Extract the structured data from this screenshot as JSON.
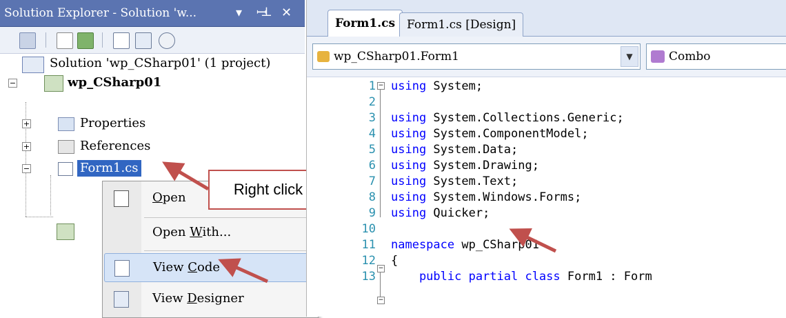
{
  "solution_explorer": {
    "title": "Solution Explorer - Solution 'w...",
    "pin_glyph": "▾ ⊥",
    "close_glyph": "✕",
    "toolbar_icons": [
      "properties-icon",
      "show-all-files-icon",
      "refresh-icon",
      "view-code-icon",
      "view-designer-icon",
      "class-diagram-icon"
    ],
    "tree": {
      "solution": "Solution 'wp_CSharp01' (1 project)",
      "project": "wp_CSharp01",
      "properties": "Properties",
      "references": "References",
      "form": "Form1.cs"
    }
  },
  "context_menu": {
    "items": [
      {
        "label": "Open",
        "mnemonic": "O"
      },
      {
        "label": "Open With...",
        "mnemonic": "W"
      },
      {
        "label": "View Code",
        "mnemonic": "C"
      },
      {
        "label": "View Designer",
        "mnemonic": "D"
      }
    ]
  },
  "callout": {
    "text": "Right click"
  },
  "editor": {
    "tabs": [
      {
        "label": "Form1.cs",
        "active": true
      },
      {
        "label": "Form1.cs [Design]",
        "active": false
      }
    ],
    "type_combo": "wp_CSharp01.Form1",
    "member_combo": "Combo",
    "code_lines": [
      {
        "n": "1",
        "pre": "using",
        "rest": " System;"
      },
      {
        "n": "2",
        "pre": "",
        "rest": ""
      },
      {
        "n": "3",
        "pre": "using",
        "rest": " System.Collections.Generic;"
      },
      {
        "n": "4",
        "pre": "using",
        "rest": " System.ComponentModel;"
      },
      {
        "n": "5",
        "pre": "using",
        "rest": " System.Data;"
      },
      {
        "n": "6",
        "pre": "using",
        "rest": " System.Drawing;"
      },
      {
        "n": "7",
        "pre": "using",
        "rest": " System.Text;"
      },
      {
        "n": "8",
        "pre": "using",
        "rest": " System.Windows.Forms;"
      },
      {
        "n": "9",
        "pre": "using",
        "rest": " Quicker;"
      },
      {
        "n": "10",
        "pre": "",
        "rest": ""
      },
      {
        "n": "11",
        "pre": "namespace",
        "rest": " wp_CSharp01"
      },
      {
        "n": "12",
        "pre": "",
        "rest": "{"
      },
      {
        "n": "13",
        "pre": "    public partial class",
        "rest": " Form1 : Form"
      }
    ]
  },
  "colors": {
    "title_bar": "#5b74b1",
    "keyword": "#0000ff",
    "line_number": "#2b91af",
    "arrow": "#c0504d",
    "selection": "#3166c2"
  }
}
